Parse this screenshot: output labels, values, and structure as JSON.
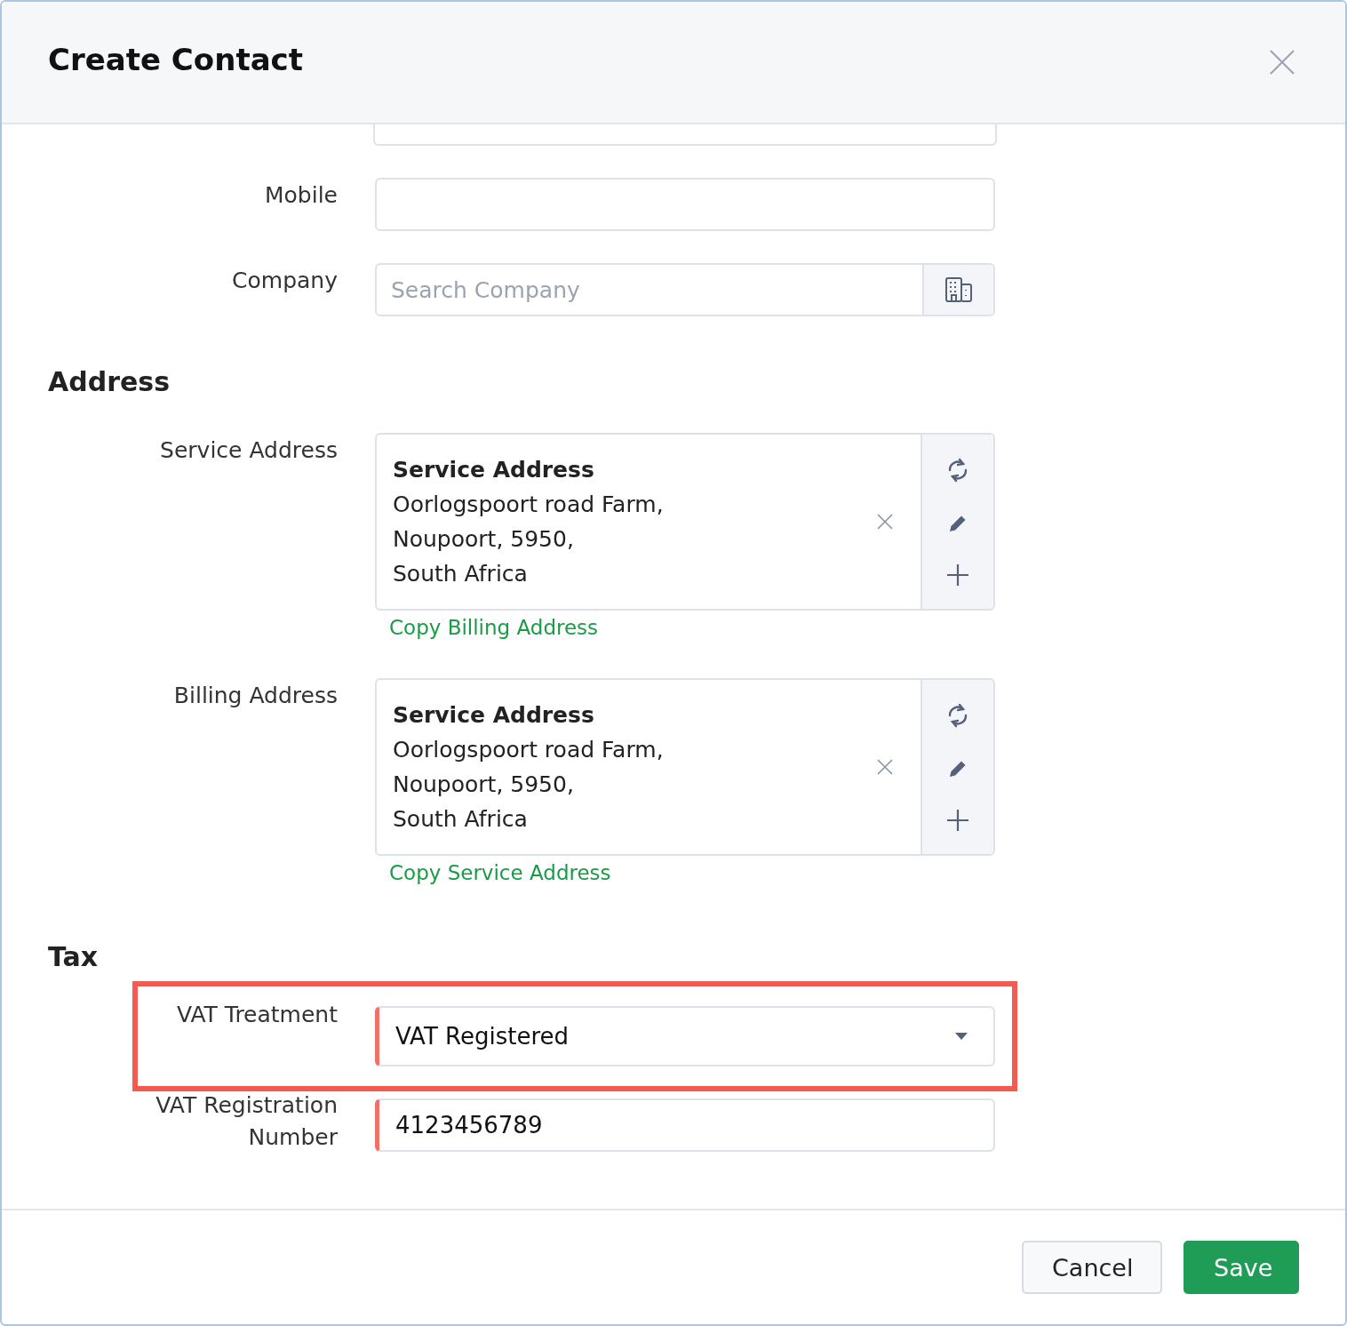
{
  "dialog": {
    "title": "Create Contact"
  },
  "contact_fields": [
    {
      "kind": "partial"
    },
    {
      "kind": "text",
      "label": "Mobile"
    },
    {
      "kind": "search",
      "label": "Company",
      "placeholder": "Search Company"
    }
  ],
  "address": {
    "heading": "Address",
    "items": [
      {
        "label": "Service Address",
        "card_title": "Service Address",
        "lines": [
          "Oorlogspoort road Farm,",
          "Noupoort, 5950,",
          "South Africa"
        ],
        "copy_link": "Copy Billing Address"
      },
      {
        "label": "Billing Address",
        "card_title": "Service Address",
        "lines": [
          "Oorlogspoort road Farm,",
          "Noupoort, 5950,",
          "South Africa"
        ],
        "copy_link": "Copy Service Address"
      }
    ]
  },
  "tax": {
    "heading": "Tax",
    "fields": [
      {
        "kind": "select",
        "label": "VAT Treatment",
        "value": "VAT Registered",
        "required": true,
        "highlighted": true
      },
      {
        "kind": "text",
        "label": "VAT Registration Number",
        "value": "4123456789",
        "required": true,
        "highlighted": false
      }
    ]
  },
  "buttons": [
    {
      "label": "Cancel",
      "kind": "secondary"
    },
    {
      "label": "Save",
      "kind": "primary"
    }
  ]
}
